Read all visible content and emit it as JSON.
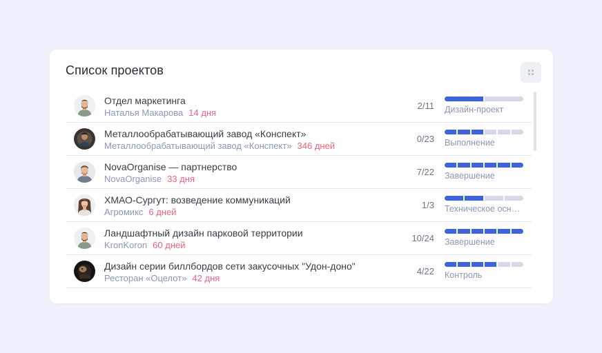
{
  "card": {
    "title": "Список проектов",
    "menu_icon": "grid-icon"
  },
  "projects": [
    {
      "title": "Отдел маркетинга",
      "company": "Наталья Макарова",
      "days": "14 дня",
      "count": "2/11",
      "stage": "Дизайн-проект",
      "progress": {
        "filled": 1,
        "total": 2
      },
      "avatar": "person-avatar"
    },
    {
      "title": "Металлообрабатывающий завод «Конспект»",
      "company": "Металлообрабатывающий завод «Конспект»",
      "days": "346 дней",
      "count": "0/23",
      "stage": "Выполнение",
      "progress": {
        "filled": 3,
        "total": 6
      },
      "avatar": "company-avatar"
    },
    {
      "title": "NovaOrganise — партнерство",
      "company": "NovaOrganise",
      "days": "33 дня",
      "count": "7/22",
      "stage": "Завершение",
      "progress": {
        "filled": 6,
        "total": 6
      },
      "avatar": "person-avatar"
    },
    {
      "title": "ХМАО-Сургут: возведение коммуникаций",
      "company": "Агромикс",
      "days": "6 дней",
      "count": "1/3",
      "stage": "Техническое основание",
      "progress": {
        "filled": 2,
        "total": 4
      },
      "avatar": "person-avatar"
    },
    {
      "title": "Ландшафтный дизайн парковой территории",
      "company": "KronKoron",
      "days": "60 дней",
      "count": "10/24",
      "stage": "Завершение",
      "progress": {
        "filled": 6,
        "total": 6
      },
      "avatar": "person-avatar"
    },
    {
      "title": "Дизайн серии биллбордов сети закусочных \"Удон-доно\"",
      "company": "Ресторан «Оцелот»",
      "days": "42 дня",
      "count": "4/22",
      "stage": "Контроль",
      "progress": {
        "filled": 4,
        "total": 6
      },
      "avatar": "company-avatar"
    }
  ],
  "colors": {
    "accent": "#3d63dd",
    "days": "#f0647a",
    "muted": "#8b96bd",
    "bar_empty": "#d5d9e6"
  }
}
